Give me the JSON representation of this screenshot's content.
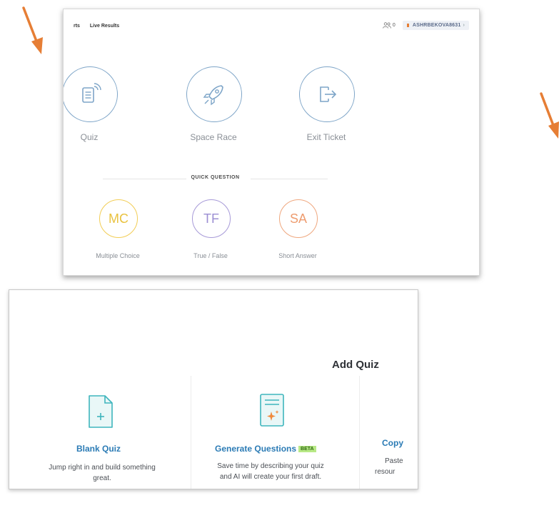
{
  "colors": {
    "arrow": "#e67e35",
    "blue_circle": "#7ea5c8",
    "mc_yellow": "#f2cd55",
    "tf_purple": "#a79ad8",
    "sa_orange": "#efa77e",
    "link_blue": "#2b7bb5",
    "beta_green": "#b8e986"
  },
  "top": {
    "nav": {
      "partial_tab": "rts",
      "live_results": "Live Results",
      "student_count": "0",
      "username": "ASHRBEKOVA8631"
    },
    "activities": [
      {
        "label": "Quiz",
        "icon": "quiz-signal-icon"
      },
      {
        "label": "Space Race",
        "icon": "rocket-icon"
      },
      {
        "label": "Exit Ticket",
        "icon": "exit-door-icon"
      }
    ],
    "quick_question": {
      "title": "QUICK QUESTION",
      "items": [
        {
          "abbr": "MC",
          "label": "Multiple Choice"
        },
        {
          "abbr": "TF",
          "label": "True / False"
        },
        {
          "abbr": "SA",
          "label": "Short Answer"
        }
      ]
    }
  },
  "bottom": {
    "title": "Add Quiz",
    "cards": [
      {
        "title": "Blank Quiz",
        "desc_line1": "Jump right in and build something",
        "desc_line2": "great.",
        "icon": "blank-document-plus-icon"
      },
      {
        "title": "Generate Questions",
        "badge": "BETA",
        "desc_line1": "Save time by describing your quiz",
        "desc_line2": "and AI will create your first draft.",
        "icon": "ai-document-sparkle-icon"
      },
      {
        "title": "Copy",
        "desc_line1": "Paste",
        "desc_line2": "resour",
        "icon": "copy-icon"
      }
    ]
  }
}
